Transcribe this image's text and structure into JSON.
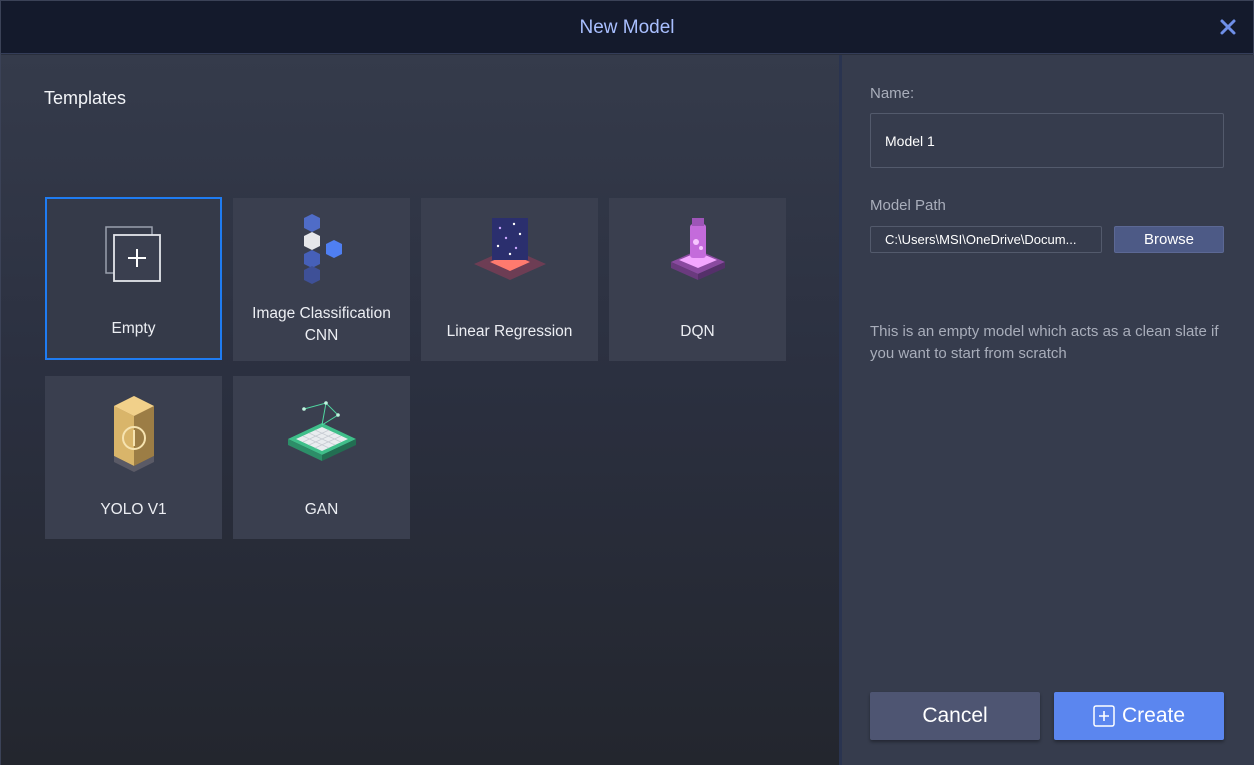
{
  "window": {
    "title": "New Model"
  },
  "templates": {
    "heading": "Templates",
    "items": [
      {
        "label": "Empty",
        "icon": "empty-template-icon",
        "selected": true
      },
      {
        "label": "Image Classification CNN",
        "icon": "cnn-cubes-icon",
        "selected": false
      },
      {
        "label": "Linear Regression",
        "icon": "linear-regression-icon",
        "selected": false
      },
      {
        "label": "DQN",
        "icon": "dqn-flask-icon",
        "selected": false
      },
      {
        "label": "YOLO V1",
        "icon": "yolo-prism-icon",
        "selected": false
      },
      {
        "label": "GAN",
        "icon": "gan-grid-icon",
        "selected": false
      }
    ]
  },
  "form": {
    "name_label": "Name:",
    "name_value": "Model 1",
    "path_label": "Model Path",
    "path_value": "C:\\Users\\MSI\\OneDrive\\Docum...",
    "browse_label": "Browse",
    "description": "This is an empty model which acts as a clean slate if you want to start from scratch"
  },
  "actions": {
    "cancel_label": "Cancel",
    "create_label": "Create"
  },
  "colors": {
    "accent": "#1f7cf2",
    "primary_button": "#5b86ef",
    "title_text": "#a9bfff"
  }
}
